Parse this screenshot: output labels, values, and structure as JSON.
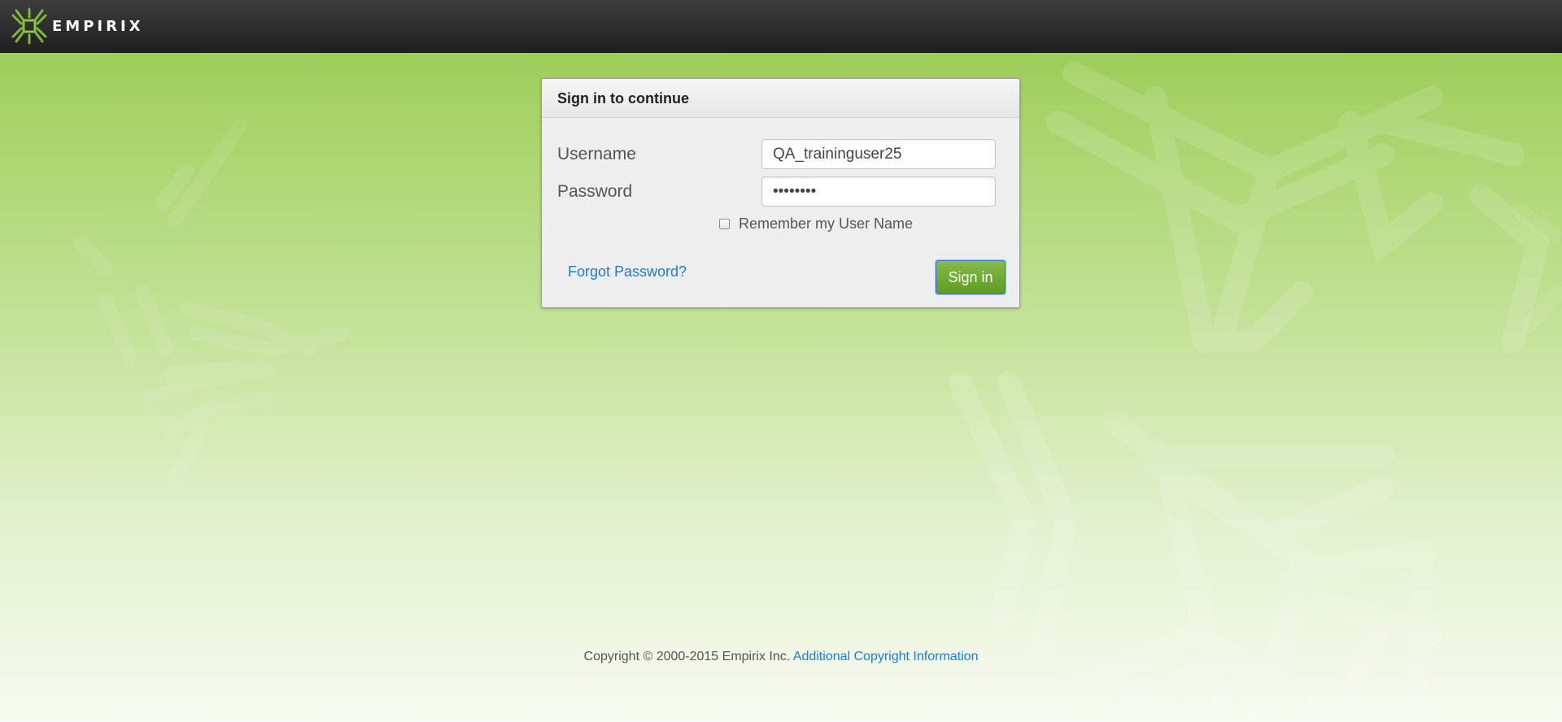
{
  "app": {
    "logo_text": "EMPIRIX"
  },
  "login": {
    "title": "Sign in to continue",
    "username_label": "Username",
    "username_value": "QA_traininguser25",
    "password_label": "Password",
    "password_value": "password",
    "remember_label": "Remember my User Name",
    "remember_checked": false,
    "forgot_label": "Forgot Password?",
    "signin_label": "Sign in"
  },
  "footer": {
    "copyright": "Copyright © 2000-2015 Empirix Inc.",
    "link_label": "Additional Copyright Information"
  },
  "colors": {
    "accent_green": "#6fab30",
    "link_blue": "#1a7fd0",
    "header_dark": "#2b2b2b"
  }
}
